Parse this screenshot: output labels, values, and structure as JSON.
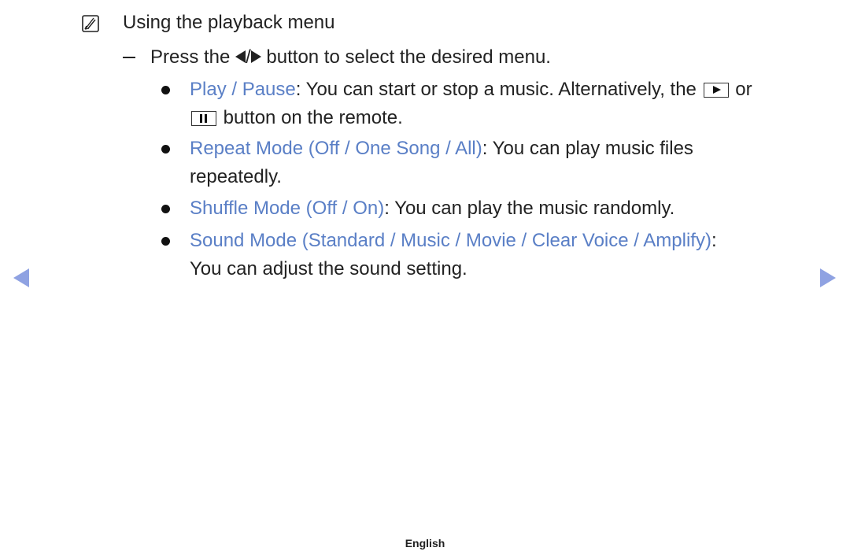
{
  "note": {
    "icon": "note-icon",
    "title": "Using the playback menu"
  },
  "instruction": {
    "prefix": "Press the",
    "separator": "/",
    "suffix": "button to select the desired menu."
  },
  "items": [
    {
      "label": "Play / Pause",
      "text_line1": ": You can start or stop a music. Alternatively, the",
      "text_or": "or",
      "text_line2": "button on the remote."
    },
    {
      "label": "Repeat Mode (Off / One Song / All)",
      "text_line1": ": You can play music files",
      "text_line2": "repeatedly."
    },
    {
      "label": "Shuffle Mode (Off / On)",
      "text_line1": ": You can play the music randomly."
    },
    {
      "label": "Sound Mode (Standard / Music / Movie / Clear Voice / Amplify)",
      "text_line1": ":",
      "text_line2": "You can adjust the sound setting."
    }
  ],
  "navigation": {
    "prev": "previous-page",
    "next": "next-page"
  },
  "footer": {
    "language": "English"
  },
  "colors": {
    "link": "#5a7fc6",
    "arrow": "#8fa2e2",
    "text": "#222222"
  }
}
